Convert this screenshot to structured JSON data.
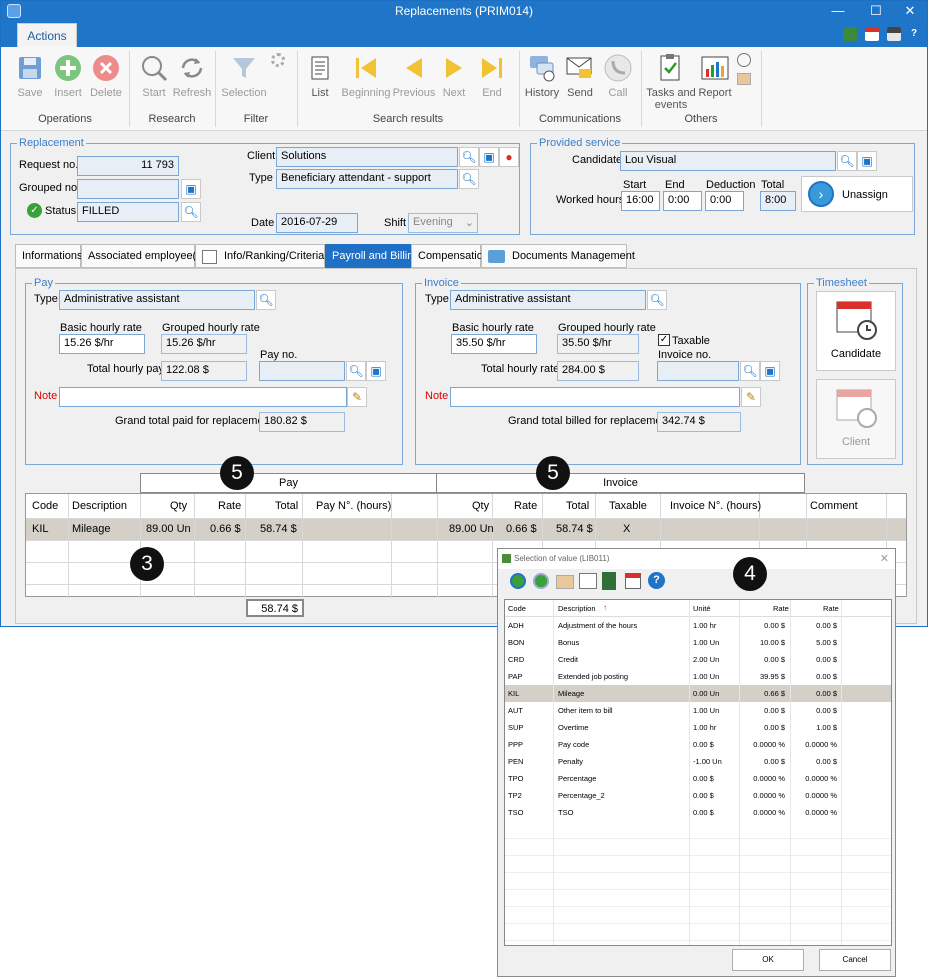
{
  "window": {
    "title": "Replacements (PRIM014)"
  },
  "ribbon": {
    "tab_label": "Actions",
    "buttons": {
      "save": "Save",
      "insert": "Insert",
      "delete": "Delete",
      "start": "Start",
      "refresh": "Refresh",
      "selection": "Selection",
      "list": "List",
      "beginning": "Beginning",
      "previous": "Previous",
      "next": "Next",
      "end": "End",
      "history": "History",
      "send": "Send",
      "call": "Call",
      "tasks": "Tasks and events",
      "report": "Report"
    },
    "groups": {
      "operations": "Operations",
      "research": "Research",
      "filter": "Filter",
      "search_results": "Search results",
      "communications": "Communications",
      "others": "Others"
    }
  },
  "replacement": {
    "legend": "Replacement",
    "request_label": "Request no.",
    "request_value": "11 793",
    "grouped_label": "Grouped no.",
    "grouped_value": "",
    "status_label": "Status",
    "status_value": "FILLED",
    "client_label": "Client",
    "client_value": "Solutions",
    "type_label": "Type",
    "type_value": "Beneficiary attendant - support",
    "date_label": "Date",
    "date_value": "2016-07-29",
    "shift_label": "Shift",
    "shift_value": "Evening"
  },
  "provided_service": {
    "legend": "Provided service",
    "candidate_label": "Candidate",
    "candidate_value": "Lou Visual",
    "worked_hours_label": "Worked hours",
    "start_label": "Start",
    "start_value": "16:00",
    "end_label": "End",
    "end_value": "0:00",
    "deduction_label": "Deduction",
    "deduction_value": "0:00",
    "total_label": "Total",
    "total_value": "8:00",
    "unassign_label": "Unassign"
  },
  "tabs": [
    "Informations",
    "Associated employee(s)",
    "Info/Ranking/Criteria",
    "Payroll and Billing",
    "Compensation",
    "Documents Management"
  ],
  "pay": {
    "legend": "Pay",
    "type_label": "Type",
    "type_value": "Administrative assistant",
    "basic_label": "Basic hourly rate",
    "basic_value": "15.26 $/hr",
    "grouped_label": "Grouped hourly rate",
    "grouped_value": "15.26 $/hr",
    "total_label": "Total hourly pay",
    "total_value": "122.08 $",
    "payno_label": "Pay no.",
    "payno_value": "",
    "note_label": "Note",
    "note_value": "",
    "grand_label": "Grand total paid for replacement",
    "grand_value": "180.82 $"
  },
  "invoice": {
    "legend": "Invoice",
    "type_label": "Type",
    "type_value": "Administrative assistant",
    "basic_label": "Basic hourly rate",
    "basic_value": "35.50 $/hr",
    "grouped_label": "Grouped hourly rate",
    "grouped_value": "35.50 $/hr",
    "taxable_label": "Taxable",
    "taxable_checked": true,
    "invno_label": "Invoice no.",
    "invno_value": "",
    "total_label": "Total hourly rate",
    "total_value": "284.00 $",
    "note_label": "Note",
    "note_value": "",
    "grand_label": "Grand total billed for replacement",
    "grand_value": "342.74 $"
  },
  "timesheet": {
    "legend": "Timesheet",
    "candidate_label": "Candidate",
    "client_label": "Client"
  },
  "expense_grid": {
    "group_headers": {
      "pay": "Pay",
      "invoice": "Invoice"
    },
    "columns": [
      "Code",
      "Description",
      "Qty",
      "Rate",
      "Total",
      "Pay N°. (hours)",
      "Qty",
      "Rate",
      "Total",
      "Taxable",
      "Invoice N°. (hours)",
      "Comment"
    ],
    "rows": [
      {
        "code": "KIL",
        "description": "Mileage",
        "pay_qty": "89.00 Un",
        "pay_rate": "0.66 $",
        "pay_total": "58.74 $",
        "pay_no": "",
        "inv_qty": "89.00 Un",
        "inv_rate": "0.66 $",
        "inv_total": "58.74 $",
        "taxable": "X",
        "inv_no": "",
        "comment": ""
      }
    ],
    "footer_total": "58.74 $"
  },
  "badges": {
    "b3": "3",
    "b4": "4",
    "b5a": "5",
    "b5b": "5"
  },
  "dialog": {
    "title": "Selection of value (LIB011)",
    "columns": [
      "Code",
      "Description",
      "Unité",
      "Rate",
      "Rate"
    ],
    "rows": [
      {
        "code": "ADH",
        "desc": "Adjustment of the hours",
        "unit": "1.00 hr",
        "rate1": "0.00 $",
        "rate2": "0.00 $"
      },
      {
        "code": "BON",
        "desc": "Bonus",
        "unit": "1.00 Un",
        "rate1": "10.00 $",
        "rate2": "5.00 $"
      },
      {
        "code": "CRD",
        "desc": "Credit",
        "unit": "2.00 Un",
        "rate1": "0.00 $",
        "rate2": "0.00 $"
      },
      {
        "code": "PAP",
        "desc": "Extended job posting",
        "unit": "1.00 Un",
        "rate1": "39.95 $",
        "rate2": "0.00 $"
      },
      {
        "code": "KIL",
        "desc": "Mileage",
        "unit": "0.00 Un",
        "rate1": "0.66 $",
        "rate2": "0.00 $"
      },
      {
        "code": "AUT",
        "desc": "Other item to bill",
        "unit": "1.00 Un",
        "rate1": "0.00 $",
        "rate2": "0.00 $"
      },
      {
        "code": "SUP",
        "desc": "Overtime",
        "unit": "1.00 hr",
        "rate1": "0.00 $",
        "rate2": "1.00 $"
      },
      {
        "code": "PPP",
        "desc": "Pay code",
        "unit": "0.00 $",
        "rate1": "0.0000 %",
        "rate2": "0.0000 %"
      },
      {
        "code": "PEN",
        "desc": "Penalty",
        "unit": "-1.00 Un",
        "rate1": "0.00 $",
        "rate2": "0.00 $"
      },
      {
        "code": "TPO",
        "desc": "Percentage",
        "unit": "0.00 $",
        "rate1": "0.0000 %",
        "rate2": "0.0000 %"
      },
      {
        "code": "TP2",
        "desc": "Percentage_2",
        "unit": "0.00 $",
        "rate1": "0.0000 %",
        "rate2": "0.0000 %"
      },
      {
        "code": "TSO",
        "desc": "TSO",
        "unit": "0.00 $",
        "rate1": "0.0000 %",
        "rate2": "0.0000 %"
      }
    ],
    "selected_code": "KIL",
    "ok_label": "OK",
    "cancel_label": "Cancel"
  },
  "colors": {
    "accent": "#1f76c9",
    "selected_row": "#d4d0c8",
    "field_border": "#7aa7d6",
    "note_red": "#e00000"
  }
}
